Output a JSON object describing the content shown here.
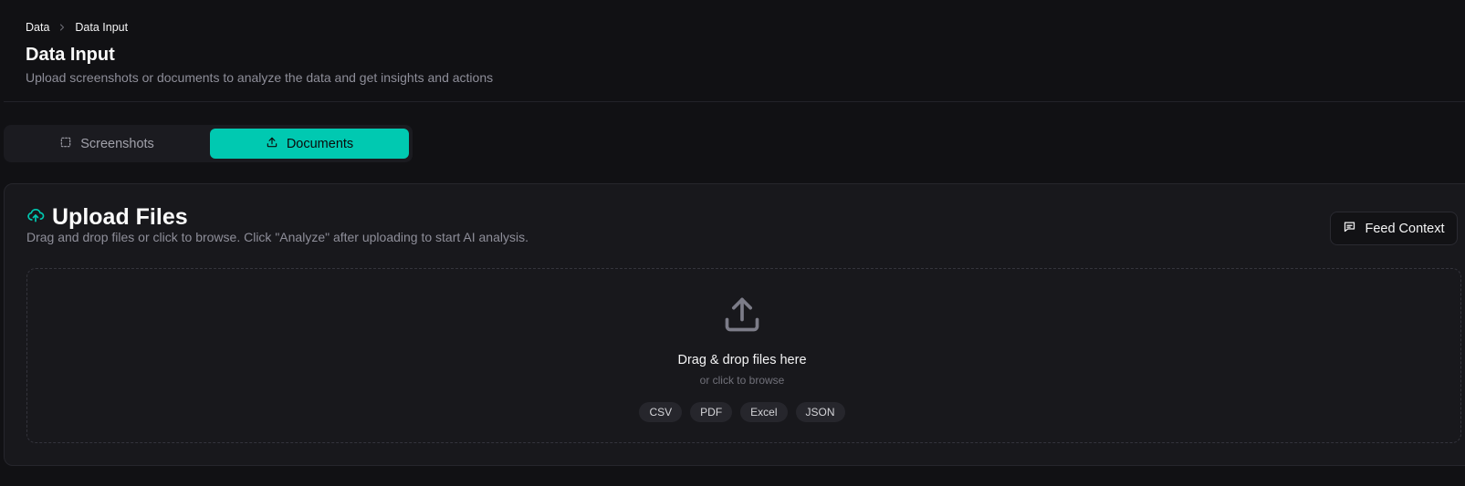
{
  "breadcrumb": {
    "parent": "Data",
    "current": "Data Input"
  },
  "header": {
    "title": "Data Input",
    "subtitle": "Upload screenshots or documents to analyze the data and get insights and actions"
  },
  "tabs": [
    {
      "label": "Screenshots",
      "icon": "dashed-square-icon",
      "active": false
    },
    {
      "label": "Documents",
      "icon": "upload-icon",
      "active": true
    }
  ],
  "upload_card": {
    "title": "Upload Files",
    "description": "Drag and drop files or click to browse. Click \"Analyze\" after uploading to start AI analysis.",
    "feed_context_label": "Feed Context",
    "dropzone": {
      "title": "Drag & drop files here",
      "subtitle": "or click to browse",
      "formats": [
        "CSV",
        "PDF",
        "Excel",
        "JSON"
      ]
    }
  },
  "colors": {
    "background": "#111114",
    "card": "#18181c",
    "accent": "#00c9b1",
    "muted_text": "#8e8e99"
  }
}
